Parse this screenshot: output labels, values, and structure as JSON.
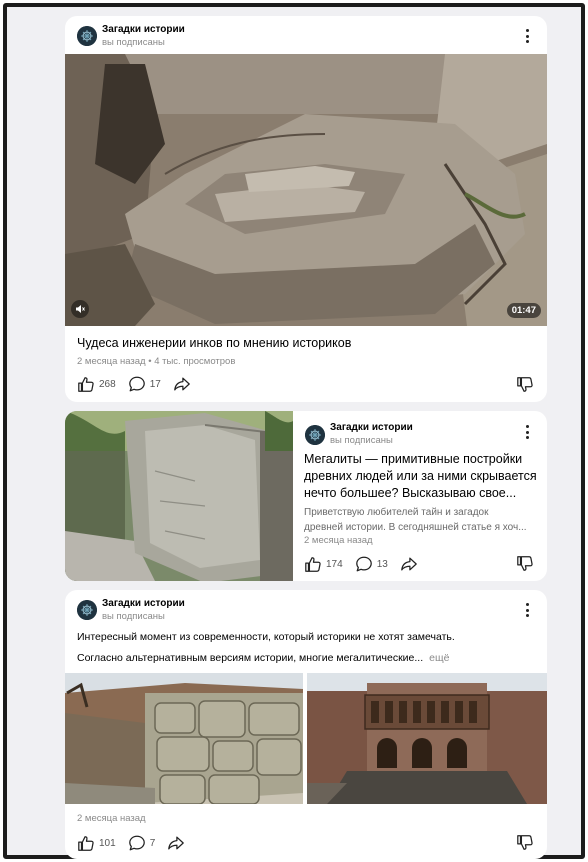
{
  "feed": {
    "cards": [
      {
        "channel": {
          "name": "Загадки истории",
          "status": "вы подписаны"
        },
        "duration": "01:47",
        "title": "Чудеса инженерии инков по мнению историков",
        "meta": "2 месяца назад • 4 тыс. просмотров",
        "likes": "268",
        "comments": "17"
      },
      {
        "channel": {
          "name": "Загадки истории",
          "status": "вы подписаны"
        },
        "title_lines": [
          "Мегалиты — примитивные постройки",
          "древних людей или за ними скрывается",
          "нечто большее? Высказываю свое..."
        ],
        "desc_lines": [
          "Приветствую любителей тайн и загадок",
          "древней истории. В сегодняшней статье я хоч..."
        ],
        "meta": "2 месяца назад",
        "likes": "174",
        "comments": "13"
      },
      {
        "channel": {
          "name": "Загадки истории",
          "status": "вы подписаны"
        },
        "text_line1": "Интересный момент из современности, который историки не хотят замечать.",
        "text_line2": "Согласно альтернативным версиям истории, многие мегалитические...",
        "more": "ещё",
        "meta": "2 месяца назад",
        "likes": "101",
        "comments": "7"
      }
    ]
  },
  "icons": {
    "avatar": "channel-logo",
    "more": "kebab-menu-icon",
    "like": "thumbs-up-icon",
    "comment": "comment-bubble-icon",
    "share": "share-arrow-icon",
    "dislike": "thumbs-down-icon",
    "mute": "speaker-muted-icon"
  },
  "colors": {
    "frame": "#1c1c1c",
    "feed_background": "#f0f0f3",
    "card": "#ffffff",
    "secondary_text": "#8a8a8a"
  }
}
